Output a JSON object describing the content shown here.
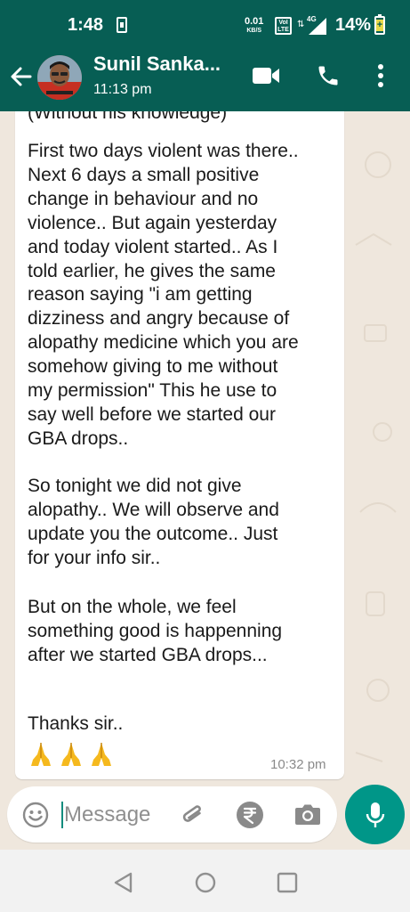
{
  "status_bar": {
    "time": "1:48",
    "net_speed_value": "0.01",
    "net_speed_unit": "KB/S",
    "volte_label_top": "VoI",
    "volte_label_bottom": "LTE",
    "signal_label": "4G",
    "battery_percent": "14%",
    "icons": [
      "sim-icon",
      "volte-icon",
      "data-arrows-icon",
      "signal-icon",
      "battery-charging-icon"
    ]
  },
  "header": {
    "contact_name": "Sunil Sanka...",
    "last_seen": "11:13 pm",
    "icons": [
      "back-arrow-icon",
      "video-call-icon",
      "phone-icon",
      "overflow-menu-icon"
    ],
    "color": "#075e54"
  },
  "message": {
    "partial_line": "(Without his knowledge)",
    "paragraph1": "First two days violent was there..\nNext 6 days a small positive\nchange in behaviour and no\nviolence..  But again yesterday\nand today violent started..  As I\ntold earlier,  he gives the same\nreason saying \"i am getting\ndizziness and angry because of\nalopathy medicine which you are\nsomehow giving to me without\nmy permission\"  This he use to\nsay well before we started our\nGBA drops..",
    "paragraph2": "So tonight we did not give\nalopathy..  We will observe and\nupdate you the outcome.. Just\nfor your info sir..",
    "paragraph3": "But on the whole,  we feel\nsomething good is happenning\nafter we started GBA drops...",
    "paragraph4": "Thanks sir..",
    "emoji_icons": [
      "folded-hands-icon",
      "folded-hands-icon",
      "folded-hands-icon"
    ],
    "time": "10:32 pm"
  },
  "composer": {
    "placeholder": "Message",
    "icons": [
      "emoji-icon",
      "attach-icon",
      "rupee-icon",
      "camera-icon",
      "mic-icon"
    ],
    "accent": "#009688"
  },
  "nav": {
    "icons": [
      "nav-back-icon",
      "nav-home-icon",
      "nav-recents-icon"
    ]
  }
}
